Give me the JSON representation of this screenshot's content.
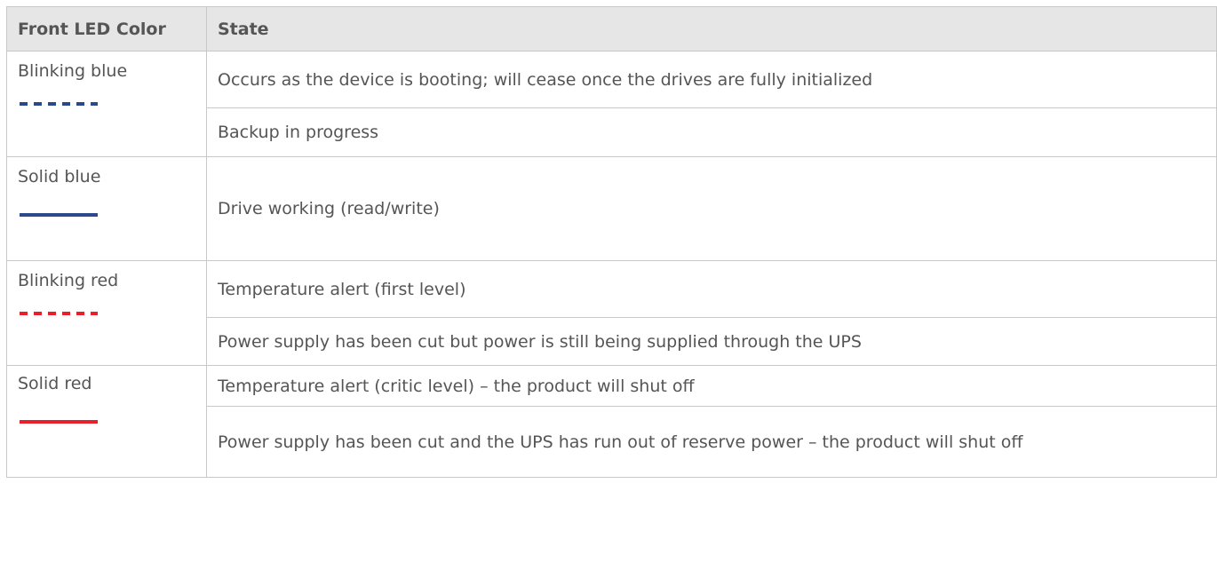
{
  "table": {
    "headers": [
      "Front LED Color",
      "State"
    ],
    "rows": [
      {
        "color_label": "Blinking blue",
        "icon": "led-blinking-blue-icon",
        "led_color": "#2b4a8b",
        "pattern": "dashed",
        "states": [
          "Occurs as the device is booting; will cease once the drives are fully initialized",
          "Backup in progress"
        ]
      },
      {
        "color_label": "Solid blue",
        "icon": "led-solid-blue-icon",
        "led_color": "#2b4a8b",
        "pattern": "solid",
        "states": [
          "Drive working (read/write)"
        ]
      },
      {
        "color_label": "Blinking red",
        "icon": "led-blinking-red-icon",
        "led_color": "#e8202a",
        "pattern": "dashed",
        "states": [
          "Temperature alert (first level)",
          "Power supply has been cut but power is still being supplied through the UPS"
        ]
      },
      {
        "color_label": "Solid red",
        "icon": "led-solid-red-icon",
        "led_color": "#e8202a",
        "pattern": "solid",
        "states": [
          "Temperature alert (critic level) – the product will shut off",
          "Power supply has been cut and the UPS has run out of reserve power – the product will shut off"
        ]
      }
    ]
  }
}
